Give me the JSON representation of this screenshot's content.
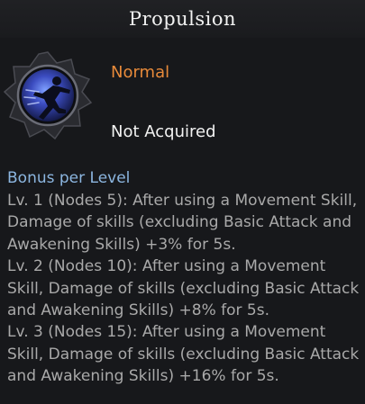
{
  "tooltip": {
    "title": "Propulsion",
    "icon": "sprinting-figure-icon",
    "grade": "Normal",
    "status": "Not Acquired",
    "bonus_heading": "Bonus per Level",
    "bonus_levels": [
      "Lv. 1 (Nodes 5): After using a Movement Skill, Damage of skills (excluding Basic Attack and Awakening Skills) +3% for 5s.",
      "Lv. 2 (Nodes 10): After using a Movement Skill, Damage of skills (excluding Basic Attack and Awakening Skills) +8% for 5s.",
      "Lv. 3 (Nodes 15): After using a Movement Skill, Damage of skills (excluding Basic Attack and Awakening Skills) +16% for 5s."
    ]
  },
  "colors": {
    "background": "#17181b",
    "grade_normal": "#e88a3a",
    "heading_blue": "#8cb6e0",
    "description_gray": "#a9a9a9"
  }
}
